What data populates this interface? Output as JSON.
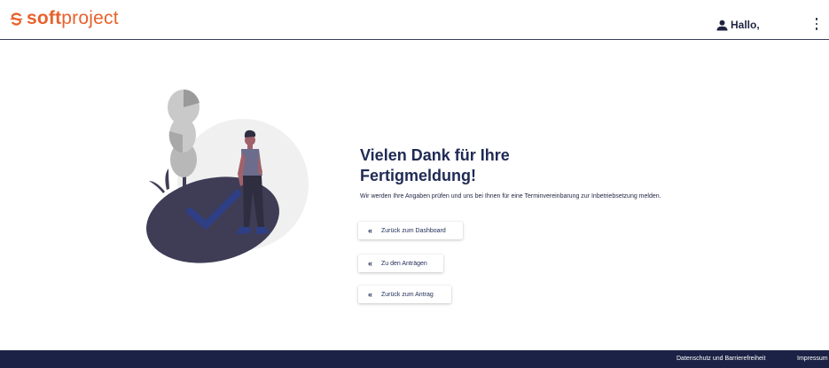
{
  "header": {
    "logo_text_bold": "soft",
    "logo_text_light": "project",
    "greeting": "Hallo,",
    "icons": {
      "user": "user-icon",
      "menu": "more-vert-icon"
    }
  },
  "main": {
    "title": "Vielen Dank für Ihre Fertigmeldung!",
    "description": "Wir werden Ihre Angaben prüfen und uns bei Ihnen für eine Terminvereinbarung zur Inbetriebsetzung melden.",
    "buttons": [
      {
        "label": "Zurück zum Dashboard",
        "icon": "double-chevron-left-icon"
      },
      {
        "label": "Zu den Anträgen",
        "icon": "double-chevron-left-icon"
      },
      {
        "label": "Zurück zum Antrag",
        "icon": "double-chevron-left-icon"
      }
    ],
    "chevron_glyph": "«"
  },
  "footer": {
    "links": [
      "Datenschutz und Barrierefreiheit",
      "Impressum"
    ]
  },
  "colors": {
    "brand": "#e8612c",
    "navy": "#1f2a55",
    "footer_bg": "#1c2245",
    "illustration_dark": "#3f3d56"
  }
}
